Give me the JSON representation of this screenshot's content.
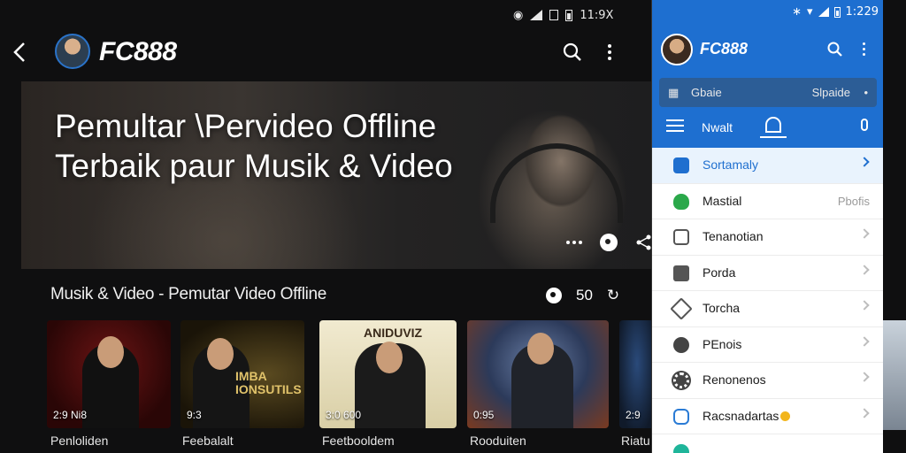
{
  "status_bar": {
    "time": "11:9X"
  },
  "app_bar": {
    "brand": "FC888"
  },
  "hero": {
    "title": "Pemultar \\Pervideo Offline Terbaik paur Musik & Video"
  },
  "section": {
    "title": "Musik & Video - Pemutar Video Offline",
    "count": "50"
  },
  "cards": [
    {
      "meta": "2:9 Ni8",
      "label": "Penloliden"
    },
    {
      "meta": "9:3",
      "label": "Feebalalt",
      "art_text": "IMBA IONSUTILS"
    },
    {
      "meta": "3:0 600",
      "label": "Feetbooldem",
      "art_text": "ANIDUVIZ"
    },
    {
      "meta": "0:95",
      "label": "Rooduiten"
    },
    {
      "meta": "2:9",
      "label": "Riatu"
    }
  ],
  "panel": {
    "status_time": "1:229",
    "brand": "FC888",
    "search": {
      "left": "Gbaie",
      "right": "Slpaide"
    },
    "tab_label": "Nwalt",
    "items": [
      {
        "label": "Sortamaly",
        "right": "",
        "icon_color": "#1f6fcf",
        "active": true
      },
      {
        "label": "Mastial",
        "right": "Pbofis",
        "icon_color": "#2aa84a",
        "active": false
      },
      {
        "label": "Tenanotian",
        "right": "",
        "icon_color": "#555555",
        "active": false
      },
      {
        "label": "Porda",
        "right": "",
        "icon_color": "#555555",
        "active": false
      },
      {
        "label": "Torcha",
        "right": "",
        "icon_color": "#555555",
        "active": false
      },
      {
        "label": "PEnois",
        "right": "",
        "icon_color": "#444444",
        "active": false
      },
      {
        "label": "Renonenos",
        "right": "",
        "icon_color": "#444444",
        "active": false
      },
      {
        "label": "Racsnadartas",
        "right": "",
        "icon_color": "#2a7bd5",
        "active": false
      }
    ]
  },
  "colors": {
    "accent": "#1e6fd0",
    "background": "#0f0f10"
  }
}
